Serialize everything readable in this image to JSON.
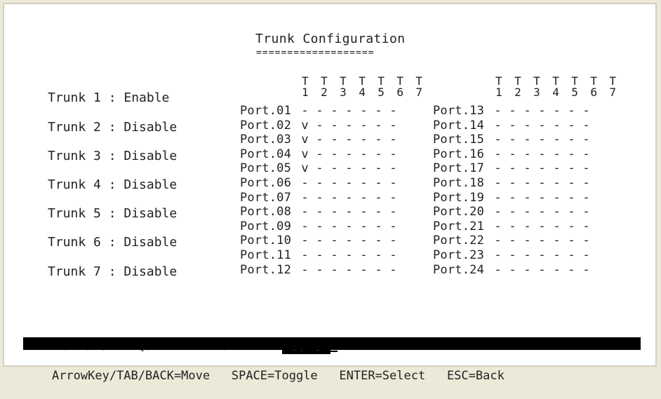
{
  "screen": {
    "title": "Trunk Configuration",
    "title_underline": "==================="
  },
  "trunks": [
    {
      "label": "Trunk 1",
      "status": "Enable"
    },
    {
      "label": "Trunk 2",
      "status": "Disable"
    },
    {
      "label": "Trunk 3",
      "status": "Disable"
    },
    {
      "label": "Trunk 4",
      "status": "Disable"
    },
    {
      "label": "Trunk 5",
      "status": "Disable"
    },
    {
      "label": "Trunk 6",
      "status": "Disable"
    },
    {
      "label": "Trunk 7",
      "status": "Disable"
    }
  ],
  "matrix": {
    "header_top": "T T T T T T T",
    "header_bottom": "1 2 3 4 5 6 7",
    "left_ports": [
      {
        "port": "Port.01",
        "marks": [
          "-",
          "-",
          "-",
          "-",
          "-",
          "-",
          "-"
        ]
      },
      {
        "port": "Port.02",
        "marks": [
          "v",
          "-",
          "-",
          "-",
          "-",
          "-",
          "-"
        ]
      },
      {
        "port": "Port.03",
        "marks": [
          "v",
          "-",
          "-",
          "-",
          "-",
          "-",
          "-"
        ]
      },
      {
        "port": "Port.04",
        "marks": [
          "v",
          "-",
          "-",
          "-",
          "-",
          "-",
          "-"
        ]
      },
      {
        "port": "Port.05",
        "marks": [
          "v",
          "-",
          "-",
          "-",
          "-",
          "-",
          "-"
        ]
      },
      {
        "port": "Port.06",
        "marks": [
          "-",
          "-",
          "-",
          "-",
          "-",
          "-",
          "-"
        ]
      },
      {
        "port": "Port.07",
        "marks": [
          "-",
          "-",
          "-",
          "-",
          "-",
          "-",
          "-"
        ]
      },
      {
        "port": "Port.08",
        "marks": [
          "-",
          "-",
          "-",
          "-",
          "-",
          "-",
          "-"
        ]
      },
      {
        "port": "Port.09",
        "marks": [
          "-",
          "-",
          "-",
          "-",
          "-",
          "-",
          "-"
        ]
      },
      {
        "port": "Port.10",
        "marks": [
          "-",
          "-",
          "-",
          "-",
          "-",
          "-",
          "-"
        ]
      },
      {
        "port": "Port.11",
        "marks": [
          "-",
          "-",
          "-",
          "-",
          "-",
          "-",
          "-"
        ]
      },
      {
        "port": "Port.12",
        "marks": [
          "-",
          "-",
          "-",
          "-",
          "-",
          "-",
          "-"
        ]
      }
    ],
    "right_ports": [
      {
        "port": "Port.13",
        "marks": [
          "-",
          "-",
          "-",
          "-",
          "-",
          "-",
          "-"
        ]
      },
      {
        "port": "Port.14",
        "marks": [
          "-",
          "-",
          "-",
          "-",
          "-",
          "-",
          "-"
        ]
      },
      {
        "port": "Port.15",
        "marks": [
          "-",
          "-",
          "-",
          "-",
          "-",
          "-",
          "-"
        ]
      },
      {
        "port": "Port.16",
        "marks": [
          "-",
          "-",
          "-",
          "-",
          "-",
          "-",
          "-"
        ]
      },
      {
        "port": "Port.17",
        "marks": [
          "-",
          "-",
          "-",
          "-",
          "-",
          "-",
          "-"
        ]
      },
      {
        "port": "Port.18",
        "marks": [
          "-",
          "-",
          "-",
          "-",
          "-",
          "-",
          "-"
        ]
      },
      {
        "port": "Port.19",
        "marks": [
          "-",
          "-",
          "-",
          "-",
          "-",
          "-",
          "-"
        ]
      },
      {
        "port": "Port.20",
        "marks": [
          "-",
          "-",
          "-",
          "-",
          "-",
          "-",
          "-"
        ]
      },
      {
        "port": "Port.21",
        "marks": [
          "-",
          "-",
          "-",
          "-",
          "-",
          "-",
          "-"
        ]
      },
      {
        "port": "Port.22",
        "marks": [
          "-",
          "-",
          "-",
          "-",
          "-",
          "-",
          "-"
        ]
      },
      {
        "port": "Port.23",
        "marks": [
          "-",
          "-",
          "-",
          "-",
          "-",
          "-",
          "-"
        ]
      },
      {
        "port": "Port.24",
        "marks": [
          "-",
          "-",
          "-",
          "-",
          "-",
          "-",
          "-"
        ]
      }
    ]
  },
  "actions": {
    "prefix": "Actions->",
    "quit": "<Quit>",
    "edit": "<Edit>",
    "save": "<Save>"
  },
  "help": {
    "move": "ArrowKey/TAB/BACK=Move",
    "toggle": "SPACE=Toggle",
    "select": "ENTER=Select",
    "back": "ESC=Back"
  },
  "colors": {
    "background": "#ffffff",
    "text": "#222222",
    "highlight_bg": "#000000",
    "highlight_fg": "#ffffff",
    "window_chrome": "#ece9d8"
  }
}
